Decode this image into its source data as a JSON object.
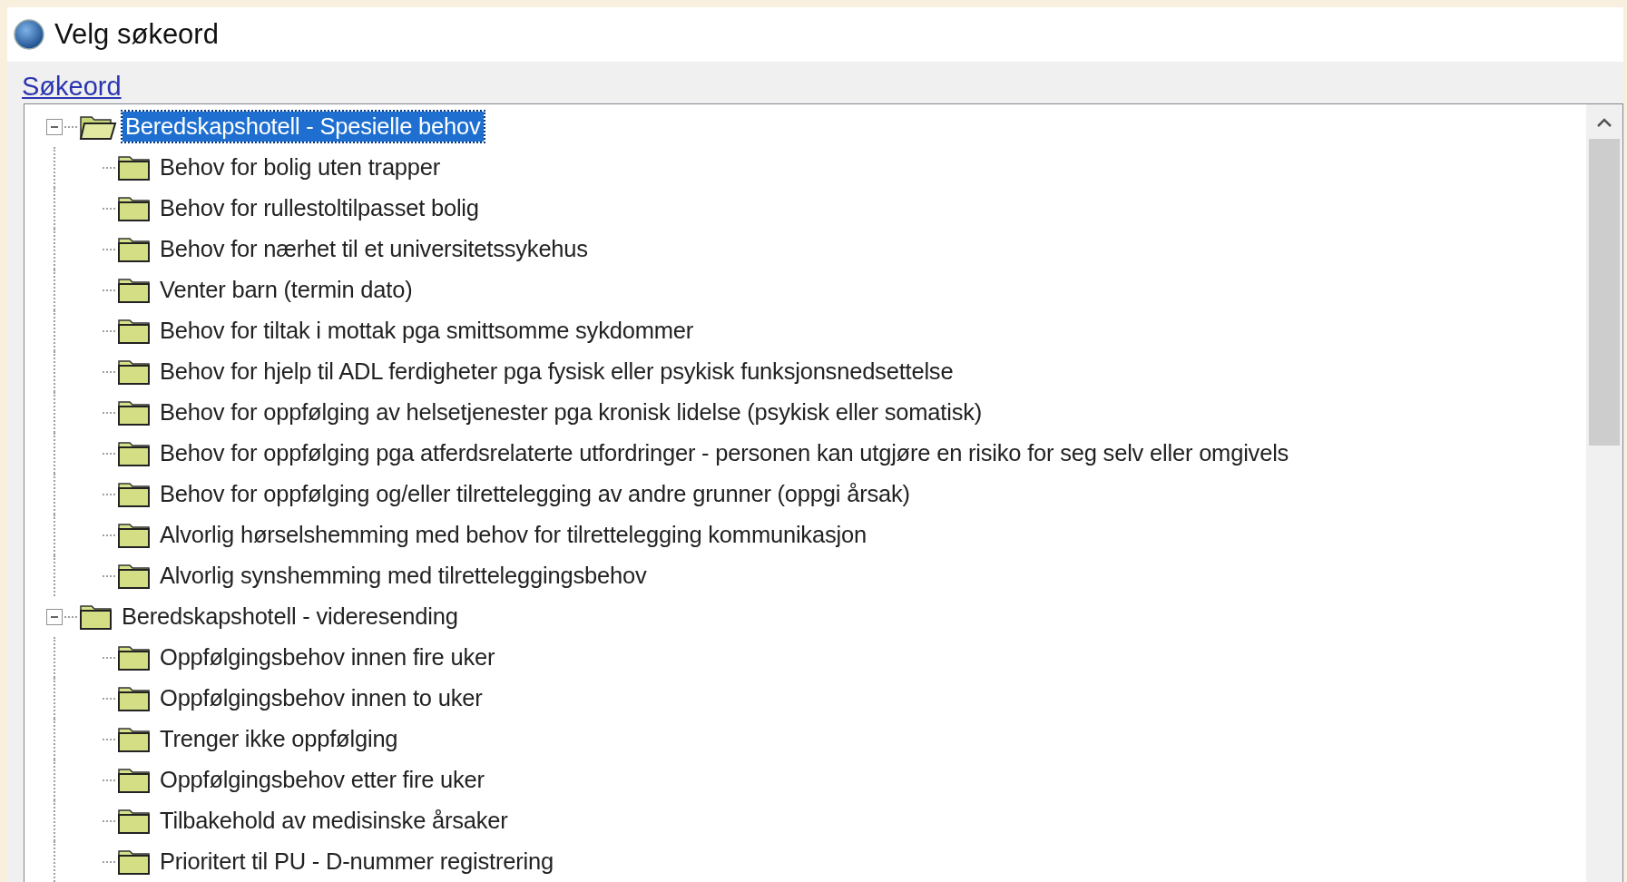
{
  "window": {
    "title": "Velg søkeord"
  },
  "search_link": "Søkeord",
  "tree": [
    {
      "label": "Beredskapshotell - Spesielle behov",
      "expanded": true,
      "selected": true,
      "children": [
        {
          "label": "Behov for bolig uten trapper",
          "selected": false
        },
        {
          "label": "Behov for rullestoltilpasset bolig",
          "selected": false
        },
        {
          "label": "Behov for nærhet til et universitetssykehus",
          "selected": false
        },
        {
          "label": "Venter barn (termin dato)",
          "selected": false
        },
        {
          "label": "Behov for tiltak i mottak pga smittsomme sykdommer",
          "selected": false
        },
        {
          "label": "Behov for hjelp til ADL ferdigheter pga fysisk eller psykisk funksjonsnedsettelse",
          "selected": false
        },
        {
          "label": "Behov for oppfølging av helsetjenester pga kronisk lidelse (psykisk eller somatisk)",
          "selected": false
        },
        {
          "label": "Behov for oppfølging pga atferdsrelaterte utfordringer - personen kan utgjøre en risiko for seg selv eller omgivels",
          "selected": false
        },
        {
          "label": "Behov for oppfølging og/eller tilrettelegging av andre grunner (oppgi årsak)",
          "selected": false
        },
        {
          "label": "Alvorlig hørselshemming med behov for tilrettelegging kommunikasjon",
          "selected": false
        },
        {
          "label": "Alvorlig synshemming med tilretteleggingsbehov",
          "selected": false
        }
      ]
    },
    {
      "label": "Beredskapshotell - videresending",
      "expanded": true,
      "selected": false,
      "children": [
        {
          "label": "Oppfølgingsbehov innen fire uker",
          "selected": false
        },
        {
          "label": "Oppfølgingsbehov innen to uker",
          "selected": false
        },
        {
          "label": "Trenger ikke oppfølging",
          "selected": false
        },
        {
          "label": "Oppfølgingsbehov etter fire uker",
          "selected": false
        },
        {
          "label": "Tilbakehold av medisinske årsaker",
          "selected": false
        },
        {
          "label": "Prioritert til PU - D-nummer registrering",
          "selected": false
        }
      ]
    }
  ]
}
